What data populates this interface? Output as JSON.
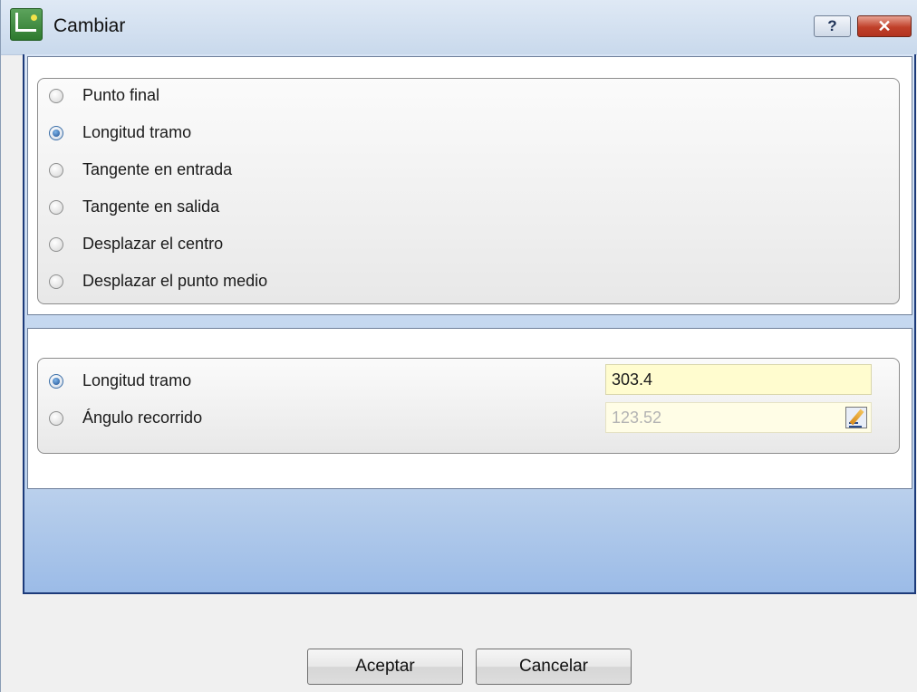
{
  "window": {
    "title": "Cambiar",
    "help_label": "?",
    "close_label": "✕"
  },
  "mode_options": [
    {
      "label": "Punto final",
      "checked": false
    },
    {
      "label": "Longitud tramo",
      "checked": true
    },
    {
      "label": "Tangente en entrada",
      "checked": false
    },
    {
      "label": "Tangente en salida",
      "checked": false
    },
    {
      "label": "Desplazar el centro",
      "checked": false
    },
    {
      "label": "Desplazar el punto medio",
      "checked": false
    }
  ],
  "params": {
    "length": {
      "label": "Longitud tramo",
      "value": "303.4",
      "checked": true
    },
    "angle": {
      "label": "Ángulo recorrido",
      "value": "123.52",
      "checked": false
    }
  },
  "buttons": {
    "ok": "Aceptar",
    "cancel": "Cancelar"
  }
}
